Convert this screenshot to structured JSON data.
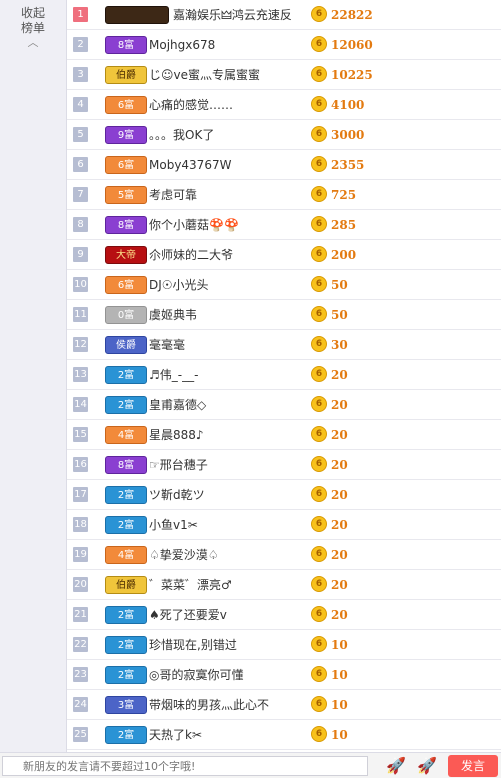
{
  "sidebar": {
    "collapse_label": "收起榜单",
    "chevron": "chevron-up-icon"
  },
  "rows": [
    {
      "rank": "1",
      "badge": "",
      "badge_style": "banner",
      "name": "嘉瀚娱乐🜲鸿云充速反",
      "count": "22822",
      "wide": true
    },
    {
      "rank": "2",
      "badge": "8富",
      "badge_style": "purple",
      "name": "Mojhgx678",
      "count": "12060"
    },
    {
      "rank": "3",
      "badge": "伯爵",
      "badge_style": "yellow",
      "name": "じ☺ve蜜灬专属蜜蜜",
      "count": "10225"
    },
    {
      "rank": "4",
      "badge": "6富",
      "badge_style": "orange",
      "name": "心痛的感觉……",
      "count": "4100"
    },
    {
      "rank": "5",
      "badge": "9富",
      "badge_style": "purple",
      "name": "。。。我OK了",
      "count": "3000"
    },
    {
      "rank": "6",
      "badge": "6富",
      "badge_style": "orange",
      "name": "Moby43767W",
      "count": "2355"
    },
    {
      "rank": "7",
      "badge": "5富",
      "badge_style": "orange",
      "name": "考虑可靠",
      "count": "725"
    },
    {
      "rank": "8",
      "badge": "8富",
      "badge_style": "purple",
      "name": "你个小蘑菇🍄🍄",
      "count": "285"
    },
    {
      "rank": "9",
      "badge": "大帝",
      "badge_style": "crown",
      "name": "尒师妹的二大爷",
      "count": "200"
    },
    {
      "rank": "10",
      "badge": "6富",
      "badge_style": "orange",
      "name": "DJ☉小光头",
      "count": "50"
    },
    {
      "rank": "11",
      "badge": "0富",
      "badge_style": "gray",
      "name": "虞姬典韦",
      "count": "50"
    },
    {
      "rank": "12",
      "badge": "侯爵",
      "badge_style": "navy",
      "name": "毫毫毫",
      "count": "30"
    },
    {
      "rank": "13",
      "badge": "2富",
      "badge_style": "blue",
      "name": "♬伟_-__-",
      "count": "20"
    },
    {
      "rank": "14",
      "badge": "2富",
      "badge_style": "blue",
      "name": "皇甫嘉德◇",
      "count": "20"
    },
    {
      "rank": "15",
      "badge": "4富",
      "badge_style": "orange",
      "name": "星晨888♪",
      "count": "20"
    },
    {
      "rank": "16",
      "badge": "8富",
      "badge_style": "purple",
      "name": "☞邢台穗子",
      "count": "20"
    },
    {
      "rank": "17",
      "badge": "2富",
      "badge_style": "blue",
      "name": "ツ靳d乾ツ",
      "count": "20"
    },
    {
      "rank": "18",
      "badge": "2富",
      "badge_style": "blue",
      "name": "小鱼v1✂",
      "count": "20"
    },
    {
      "rank": "19",
      "badge": "4富",
      "badge_style": "orange",
      "name": "♤挚爱沙漠♤",
      "count": "20"
    },
    {
      "rank": "20",
      "badge": "伯爵",
      "badge_style": "yellow",
      "name": "゛菜菜゛漂亮♂",
      "count": "20"
    },
    {
      "rank": "21",
      "badge": "2富",
      "badge_style": "blue",
      "name": "♠死了还要爱v",
      "count": "20"
    },
    {
      "rank": "22",
      "badge": "2富",
      "badge_style": "blue",
      "name": "珍惜现在,别错过",
      "count": "10"
    },
    {
      "rank": "23",
      "badge": "2富",
      "badge_style": "blue",
      "name": "◎哥的寂寞你可懂",
      "count": "10"
    },
    {
      "rank": "24",
      "badge": "3富",
      "badge_style": "navy",
      "name": "带烟味的男孩灬此心不",
      "count": "10"
    },
    {
      "rank": "25",
      "badge": "2富",
      "badge_style": "blue",
      "name": "天热了k✂",
      "count": "10"
    }
  ],
  "coin_glyph": "6",
  "bottom": {
    "input_placeholder": "新朋友的发言请不要超过10个字哦!",
    "rocket1_glyph": "🚀",
    "rocket2_glyph": "🚀",
    "send_label": "发言"
  },
  "colors": {
    "rank_default": "#b6bdd2",
    "rank_first": "#ef6f7e",
    "coin": "#f7c11c",
    "count_text": "#e37a10",
    "send_button": "#fb5a55"
  }
}
